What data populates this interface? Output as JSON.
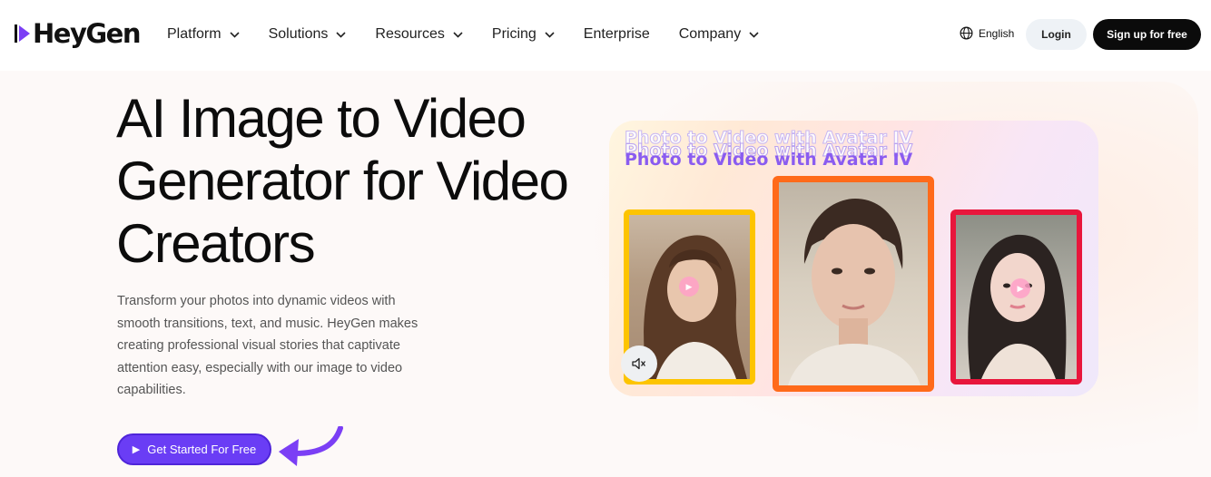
{
  "brand": {
    "name": "HeyGen",
    "accent": "#7b3ff5"
  },
  "nav": {
    "items": [
      {
        "label": "Platform",
        "dropdown": true
      },
      {
        "label": "Solutions",
        "dropdown": true
      },
      {
        "label": "Resources",
        "dropdown": true
      },
      {
        "label": "Pricing",
        "dropdown": true
      },
      {
        "label": "Enterprise",
        "dropdown": false
      },
      {
        "label": "Company",
        "dropdown": true
      }
    ],
    "language": "English",
    "login_label": "Login",
    "signup_label": "Sign up for free"
  },
  "hero": {
    "title": "AI Image to Video Generator for Video Creators",
    "description": "Transform your photos into dynamic videos with smooth transitions, text, and music. HeyGen makes creating professional visual stories that captivate attention easy, especially with our image to video capabilities.",
    "cta_label": "Get Started For Free"
  },
  "showcase": {
    "title": "Photo to Video with Avatar IV",
    "frame_colors": [
      "#fdc400",
      "#ff6a1a",
      "#e8163c"
    ]
  },
  "icons": {
    "globe": "globe-icon",
    "chevron": "chevron-down-icon",
    "mute": "speaker-muted-icon",
    "play": "play-icon",
    "arrow": "curved-arrow-icon"
  }
}
